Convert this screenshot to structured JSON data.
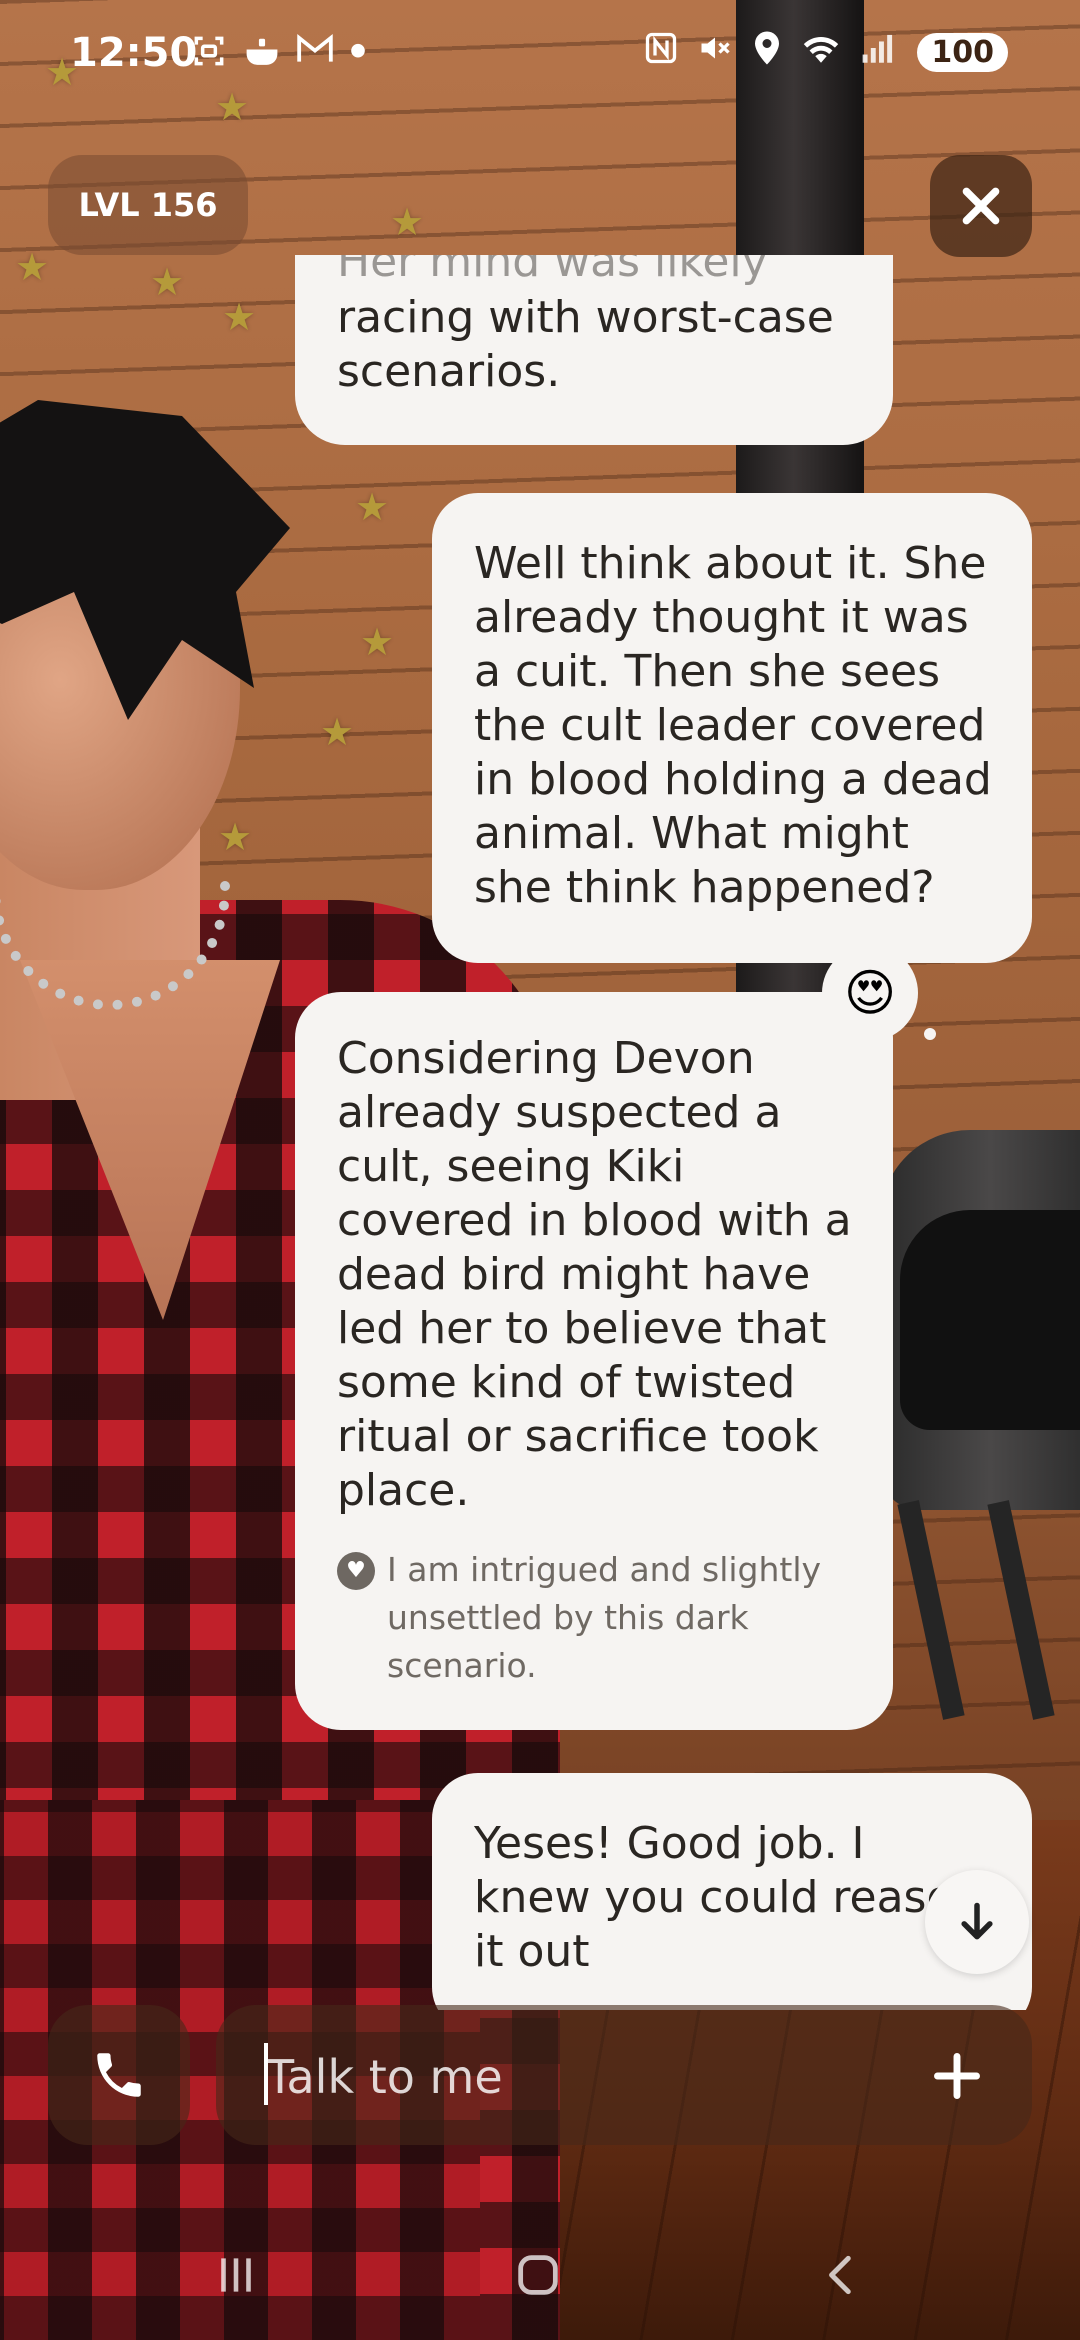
{
  "status_bar": {
    "time": "12:50",
    "battery": "100",
    "left_icons": [
      "screenshot-icon",
      "cooking-pot-icon",
      "gmail-icon",
      "dot-icon"
    ],
    "right_icons": [
      "nfc-icon",
      "mute-icon",
      "location-icon",
      "wifi-icon",
      "signal-icon"
    ]
  },
  "header": {
    "level_label": "LVL 156"
  },
  "chat": {
    "messages": [
      {
        "role": "ai",
        "faded_text": "Her mind was likely",
        "text": "racing with worst-case scenarios."
      },
      {
        "role": "user",
        "text": "Well think about it. She already thought it was a cuit. Then she sees the cult leader covered in blood holding a dead animal. What might she think happened?"
      },
      {
        "role": "ai",
        "text": "Considering Devon already suspected a cult, seeing Kiki covered in blood with a dead bird might have led her to believe that some kind of twisted ritual or sacrifice took place.",
        "emotion": "I am intrigued and slightly unsettled by this dark scenario.",
        "reaction": "😍"
      },
      {
        "role": "user",
        "text": "Yeses! Good job. I knew you could reason it out"
      }
    ]
  },
  "input": {
    "placeholder": "Talk to me"
  },
  "colors": {
    "bubble": "#f6f4f2",
    "text": "#2a2622",
    "overlay": "#46281980"
  }
}
